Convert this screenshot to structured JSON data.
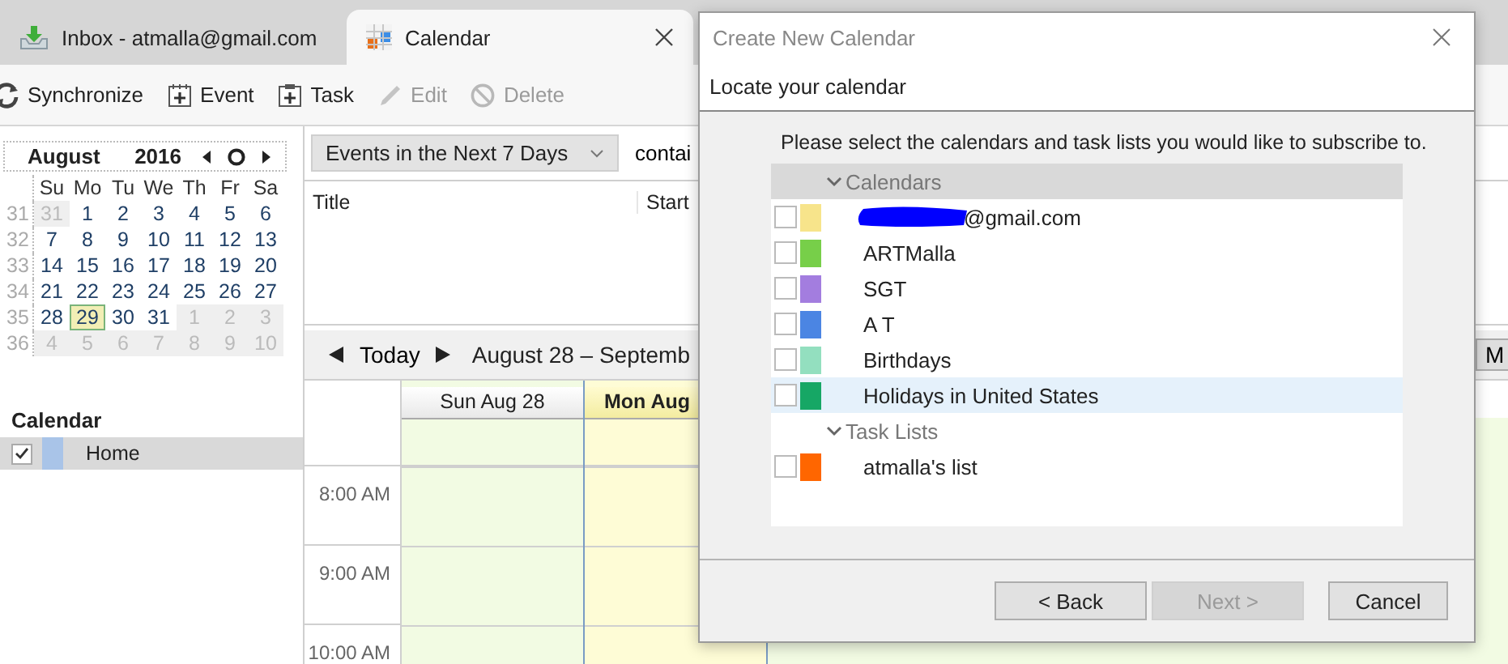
{
  "tabs": [
    {
      "label": "Inbox - atmalla@gmail.com",
      "kind": "mail",
      "selected": false,
      "closable": false
    },
    {
      "label": "Calendar",
      "kind": "calendar",
      "selected": true,
      "closable": true
    }
  ],
  "toolbar": [
    {
      "label": "Synchronize",
      "kind": "sync",
      "disabled": false
    },
    {
      "label": "Event",
      "kind": "event",
      "disabled": false
    },
    {
      "label": "Task",
      "kind": "task",
      "disabled": false
    },
    {
      "label": "Edit",
      "kind": "edit",
      "disabled": true
    },
    {
      "label": "Delete",
      "kind": "delete",
      "disabled": true
    }
  ],
  "mini_calendar": {
    "month": "August",
    "year": "2016",
    "weekdays": [
      "Su",
      "Mo",
      "Tu",
      "We",
      "Th",
      "Fr",
      "Sa"
    ],
    "weeks": [
      {
        "number": "31",
        "days": [
          {
            "label": "31",
            "in_month": false,
            "selected": false
          },
          {
            "label": "1",
            "in_month": true,
            "selected": false
          },
          {
            "label": "2",
            "in_month": true,
            "selected": false
          },
          {
            "label": "3",
            "in_month": true,
            "selected": false
          },
          {
            "label": "4",
            "in_month": true,
            "selected": false
          },
          {
            "label": "5",
            "in_month": true,
            "selected": false
          },
          {
            "label": "6",
            "in_month": true,
            "selected": false
          }
        ]
      },
      {
        "number": "32",
        "days": [
          {
            "label": "7",
            "in_month": true,
            "selected": false
          },
          {
            "label": "8",
            "in_month": true,
            "selected": false
          },
          {
            "label": "9",
            "in_month": true,
            "selected": false
          },
          {
            "label": "10",
            "in_month": true,
            "selected": false
          },
          {
            "label": "11",
            "in_month": true,
            "selected": false
          },
          {
            "label": "12",
            "in_month": true,
            "selected": false
          },
          {
            "label": "13",
            "in_month": true,
            "selected": false
          }
        ]
      },
      {
        "number": "33",
        "days": [
          {
            "label": "14",
            "in_month": true,
            "selected": false
          },
          {
            "label": "15",
            "in_month": true,
            "selected": false
          },
          {
            "label": "16",
            "in_month": true,
            "selected": false
          },
          {
            "label": "17",
            "in_month": true,
            "selected": false
          },
          {
            "label": "18",
            "in_month": true,
            "selected": false
          },
          {
            "label": "19",
            "in_month": true,
            "selected": false
          },
          {
            "label": "20",
            "in_month": true,
            "selected": false
          }
        ]
      },
      {
        "number": "34",
        "days": [
          {
            "label": "21",
            "in_month": true,
            "selected": false
          },
          {
            "label": "22",
            "in_month": true,
            "selected": false
          },
          {
            "label": "23",
            "in_month": true,
            "selected": false
          },
          {
            "label": "24",
            "in_month": true,
            "selected": false
          },
          {
            "label": "25",
            "in_month": true,
            "selected": false
          },
          {
            "label": "26",
            "in_month": true,
            "selected": false
          },
          {
            "label": "27",
            "in_month": true,
            "selected": false
          }
        ]
      },
      {
        "number": "35",
        "days": [
          {
            "label": "28",
            "in_month": true,
            "selected": false
          },
          {
            "label": "29",
            "in_month": true,
            "selected": true
          },
          {
            "label": "30",
            "in_month": true,
            "selected": false
          },
          {
            "label": "31",
            "in_month": true,
            "selected": false
          },
          {
            "label": "1",
            "in_month": false,
            "selected": false
          },
          {
            "label": "2",
            "in_month": false,
            "selected": false
          },
          {
            "label": "3",
            "in_month": false,
            "selected": false
          }
        ]
      },
      {
        "number": "36",
        "days": [
          {
            "label": "4",
            "in_month": false,
            "selected": false
          },
          {
            "label": "5",
            "in_month": false,
            "selected": false
          },
          {
            "label": "6",
            "in_month": false,
            "selected": false
          },
          {
            "label": "7",
            "in_month": false,
            "selected": false
          },
          {
            "label": "8",
            "in_month": false,
            "selected": false
          },
          {
            "label": "9",
            "in_month": false,
            "selected": false
          },
          {
            "label": "10",
            "in_month": false,
            "selected": false
          }
        ]
      }
    ]
  },
  "calendar_list": {
    "title": "Calendar",
    "items": [
      {
        "name": "Home",
        "checked": true,
        "color": "#a9c4e8",
        "selected": true
      }
    ]
  },
  "events_filter": {
    "value": "Events in the Next 7 Days"
  },
  "search": {
    "value": "contai"
  },
  "events_table": {
    "columns": [
      "Title",
      "Start"
    ]
  },
  "navigation": {
    "today": "Today",
    "range": "August 28 – Septemb",
    "view_button": "M"
  },
  "day_view": {
    "columns": [
      {
        "label": "Sun Aug 28",
        "today": false
      },
      {
        "label": "Mon Aug",
        "today": true
      }
    ],
    "times": [
      "8:00 AM",
      "9:00 AM",
      "10:00 AM"
    ]
  },
  "dialog": {
    "title": "Create New Calendar",
    "heading": "Locate your calendar",
    "instruction": "Please select the calendars and task lists you would like to subscribe to.",
    "groups": [
      {
        "label": "Calendars",
        "expanded": true,
        "selected": true,
        "items": [
          {
            "name": "@gmail.com",
            "redacted": true,
            "checked": false,
            "color": "#f7e48b",
            "selected": false
          },
          {
            "name": "ARTMalla",
            "redacted": false,
            "checked": false,
            "color": "#77cf49",
            "selected": false
          },
          {
            "name": "SGT",
            "redacted": false,
            "checked": false,
            "color": "#a37ddf",
            "selected": false
          },
          {
            "name": "A T",
            "redacted": false,
            "checked": false,
            "color": "#4b85e3",
            "selected": false
          },
          {
            "name": "Birthdays",
            "redacted": false,
            "checked": false,
            "color": "#93dfbf",
            "selected": false
          },
          {
            "name": "Holidays in United States",
            "redacted": false,
            "checked": false,
            "color": "#16a765",
            "selected": true
          }
        ]
      },
      {
        "label": "Task Lists",
        "expanded": true,
        "selected": false,
        "items": [
          {
            "name": "atmalla's list",
            "redacted": false,
            "checked": false,
            "color": "#ff6600",
            "selected": false
          }
        ]
      }
    ],
    "buttons": [
      {
        "label": "< Back",
        "disabled": false
      },
      {
        "label": "Next >",
        "disabled": true
      },
      {
        "label": "Cancel",
        "disabled": false
      }
    ]
  }
}
